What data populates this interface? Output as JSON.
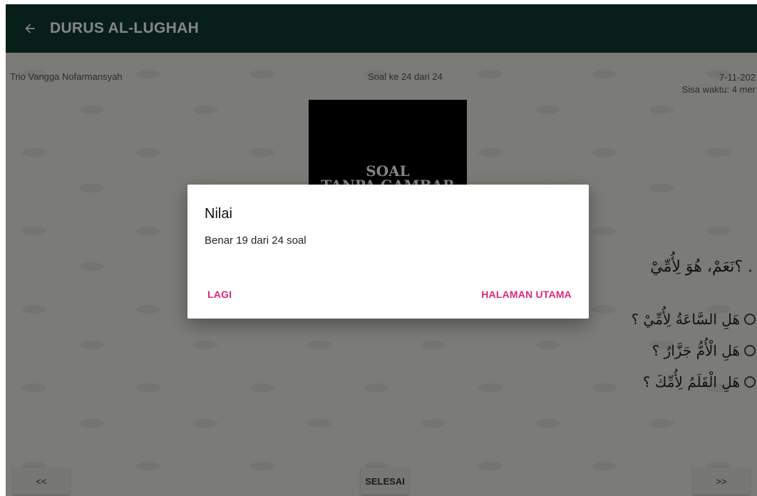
{
  "app": {
    "title": "DURUS AL-LUGHAH"
  },
  "meta": {
    "student_name": "Trio Vangga Nofarmansyah",
    "question_counter": "Soal ke 24 dari 24",
    "date": "7-11-202",
    "time_left": "Sisa waktu: 4 mer"
  },
  "question_image": {
    "line1": "SOAL",
    "line2": "TANPA GAMBAR"
  },
  "question": {
    "text": ". ؟نَعَمْ، هُوَ لِأُمِّيْ"
  },
  "options": [
    {
      "text": "هَلِ السَّاعَةُ لِأُمِّيْ ؟"
    },
    {
      "text": "هَلِ الْأُمُّ جَزَّارٌ ؟"
    },
    {
      "text": "هَلِ الْقَلَمُ لِأُمِّكَ ؟"
    }
  ],
  "nav": {
    "prev_label": "<<",
    "finish_label": "SELESAI",
    "next_label": ">>"
  },
  "dialog": {
    "title": "Nilai",
    "message": "Benar 19 dari 24 soal",
    "again_label": "LAGI",
    "home_label": "HALAMAN UTAMA"
  },
  "colors": {
    "appbar": "#0f3a30",
    "accent": "#e0287c"
  },
  "icons": {
    "back": "arrow-left-icon"
  }
}
